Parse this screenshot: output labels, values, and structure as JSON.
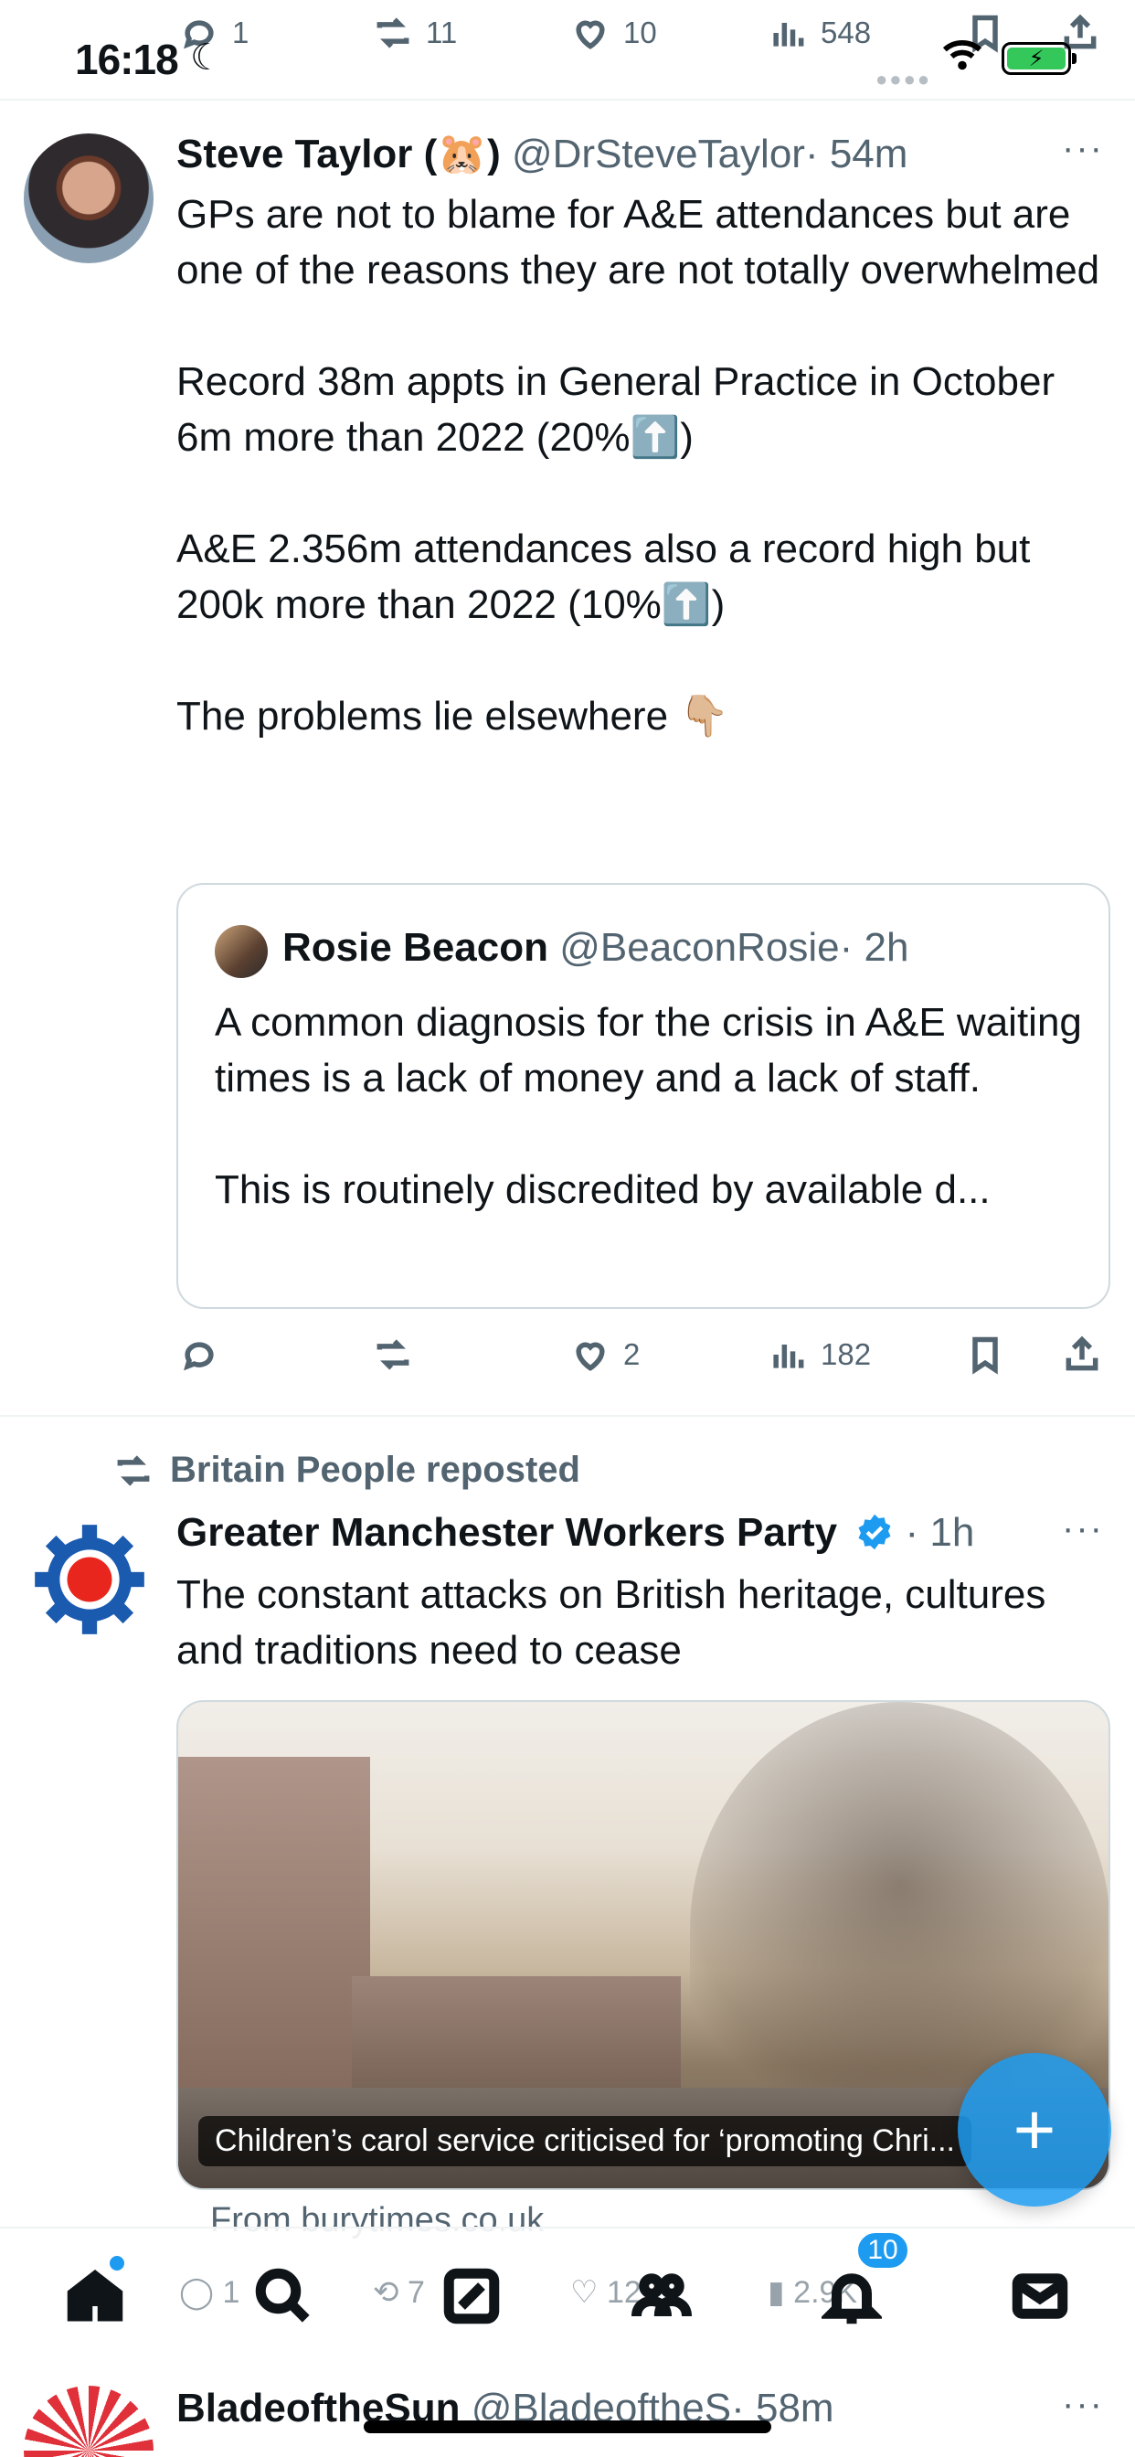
{
  "status_bar": {
    "time": "16:18"
  },
  "top_actions": {
    "replies": "1",
    "reposts": "11",
    "likes": "10",
    "views": "548"
  },
  "tweet1": {
    "name": "Steve Taylor (🐹)",
    "handle": "@DrSteveTaylor",
    "time": "· 54m",
    "text": "GPs are not to blame for A&E attendances but are one of the reasons they are not totally overwhelmed\n\nRecord 38m appts in General Practice in October\n6m more than 2022 (20%⬆️)\n\nA&E 2.356m attendances also a record high but 200k more than 2022 (10%⬆️)\n\nThe problems lie elsewhere 👇🏼",
    "quote": {
      "name": "Rosie Beacon",
      "handle": "@BeaconRosie",
      "time": "· 2h",
      "text": "A common diagnosis for the crisis in A&E waiting times is a lack of money and a lack of staff.\n\nThis is routinely discredited by available d..."
    },
    "actions": {
      "likes": "2",
      "views": "182"
    }
  },
  "tweet2": {
    "repost_by": "Britain People reposted",
    "name": "Greater Manchester Workers Party",
    "time": "· 1h",
    "text": "The constant attacks on British heritage, cultures and traditions need to cease",
    "media_caption": "Children’s carol service criticised for ‘promoting Chri...",
    "link_source": "From burytimes.co.uk",
    "ghost_actions": {
      "replies": "1",
      "reposts": "7",
      "likes": "12",
      "views": "2.9K"
    }
  },
  "tweet3": {
    "name": "BladeoftheSun",
    "handle": "@BladeoftheS",
    "time": "· 58m"
  },
  "bottom_nav": {
    "notifications_badge": "10"
  },
  "colors": {
    "accent": "#1d9bf0",
    "secondary_text": "#536471",
    "primary_text": "#0f1419"
  }
}
